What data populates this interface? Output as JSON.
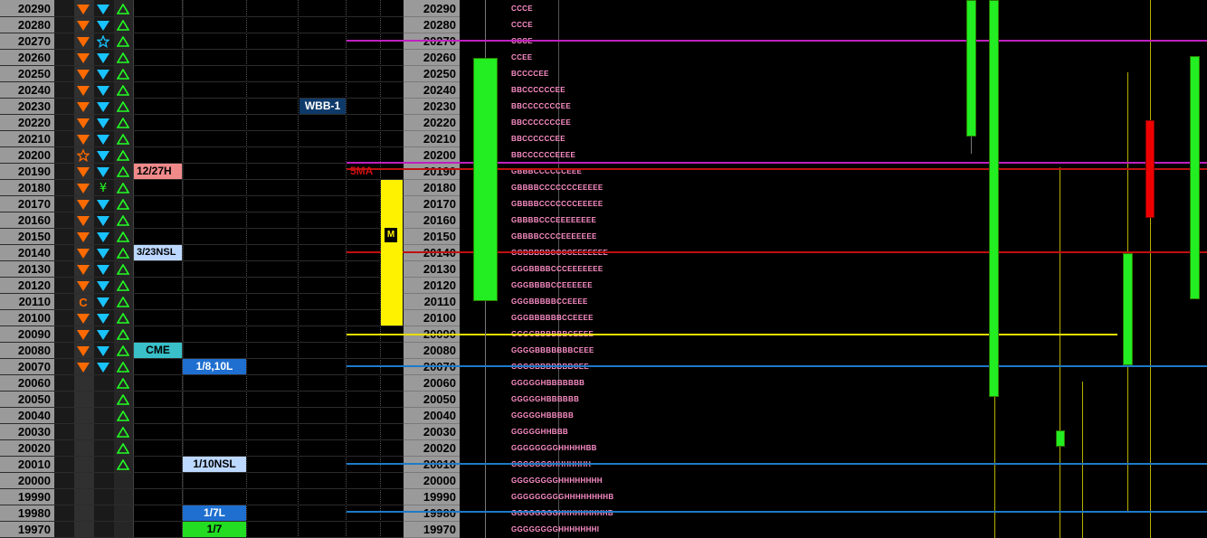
{
  "price_ladder": {
    "rows": [
      {
        "price": "20290",
        "marks": [
          "tri-down",
          "tri-down",
          "tri-up"
        ],
        "tpo": "CCCE"
      },
      {
        "price": "20280",
        "marks": [
          "tri-down",
          "tri-down",
          "tri-up"
        ],
        "tpo": "CCCE"
      },
      {
        "price": "20270",
        "marks": [
          "tri-down",
          "star",
          "tri-up"
        ],
        "tpo": "CCCE"
      },
      {
        "price": "20260",
        "marks": [
          "tri-down",
          "tri-down",
          "tri-up"
        ],
        "tpo": "CCEE"
      },
      {
        "price": "20250",
        "marks": [
          "tri-down",
          "tri-down",
          "tri-up"
        ],
        "tpo": "BCCCCEE"
      },
      {
        "price": "20240",
        "marks": [
          "tri-down",
          "tri-down",
          "tri-up"
        ],
        "tpo": "BBCCCCCCEE"
      },
      {
        "price": "20230",
        "marks": [
          "tri-down",
          "tri-down",
          "tri-up"
        ],
        "tpo": "BBCCCCCCCEE"
      },
      {
        "price": "20220",
        "marks": [
          "tri-down",
          "tri-down",
          "tri-up"
        ],
        "tpo": "BBCCCCCCCEE"
      },
      {
        "price": "20210",
        "marks": [
          "tri-down",
          "tri-down",
          "tri-up"
        ],
        "tpo": "BBCCCCCCEE"
      },
      {
        "price": "20200",
        "marks": [
          "star",
          "tri-down",
          "tri-up"
        ],
        "tpo": "BBCCCCCCEEEE"
      },
      {
        "price": "20190",
        "marks": [
          "tri-down",
          "tri-down",
          "tri-up"
        ],
        "tpo": "GBBBCCCCCCEEE"
      },
      {
        "price": "20180",
        "marks": [
          "tri-down",
          "yen",
          "tri-up"
        ],
        "tpo": "GBBBBCCCCCCCEEEEE"
      },
      {
        "price": "20170",
        "marks": [
          "tri-down",
          "tri-down",
          "tri-up"
        ],
        "tpo": "GBBBBCCCCCCCEEEEE"
      },
      {
        "price": "20160",
        "marks": [
          "tri-down",
          "tri-down",
          "tri-up"
        ],
        "tpo": "GBBBBCCCEEEEEEEE"
      },
      {
        "price": "20150",
        "marks": [
          "tri-down",
          "tri-down",
          "tri-up"
        ],
        "tpo": "GBBBBCCCCEEEEEEE"
      },
      {
        "price": "20140",
        "marks": [
          "tri-down",
          "tri-down",
          "tri-up"
        ],
        "tpo": "GGBBBBBCCCCEEEEEEE"
      },
      {
        "price": "20130",
        "marks": [
          "tri-down",
          "tri-down",
          "tri-up"
        ],
        "tpo": "GGGBBBBCCCEEEEEEE"
      },
      {
        "price": "20120",
        "marks": [
          "tri-down",
          "tri-down",
          "tri-up"
        ],
        "tpo": "GGGBBBBCCEEEEEE"
      },
      {
        "price": "20110",
        "marks": [
          "C",
          "tri-down",
          "tri-up"
        ],
        "tpo": "GGGBBBBBCCEEEE"
      },
      {
        "price": "20100",
        "marks": [
          "tri-down",
          "tri-down",
          "tri-up"
        ],
        "tpo": "GGGBBBBBBCCEEEE"
      },
      {
        "price": "20090",
        "marks": [
          "tri-down",
          "tri-down",
          "tri-up"
        ],
        "tpo": "GGGGBBBBBBCEEEE"
      },
      {
        "price": "20080",
        "marks": [
          "tri-down",
          "tri-down",
          "tri-up"
        ],
        "tpo": "GGGGBBBBBBBCEEE"
      },
      {
        "price": "20070",
        "marks": [
          "tri-down",
          "tri-down",
          "tri-up"
        ],
        "tpo": "GGGGBBBBBBBCEE"
      },
      {
        "price": "20060",
        "marks": [
          "",
          "",
          "tri-up"
        ],
        "tpo": "GGGGGHBBBBBBB"
      },
      {
        "price": "20050",
        "marks": [
          "",
          "",
          "tri-up"
        ],
        "tpo": "GGGGGHBBBBBB"
      },
      {
        "price": "20040",
        "marks": [
          "",
          "",
          "tri-up"
        ],
        "tpo": "GGGGGHBBBBB"
      },
      {
        "price": "20030",
        "marks": [
          "",
          "",
          "tri-up"
        ],
        "tpo": "GGGGGHHBBB"
      },
      {
        "price": "20020",
        "marks": [
          "",
          "",
          "tri-up"
        ],
        "tpo": "GGGGGGGGHHHHHBB"
      },
      {
        "price": "20010",
        "marks": [
          "",
          "",
          "tri-up"
        ],
        "tpo": "GGGGGGGHHHHHHH"
      },
      {
        "price": "20000",
        "marks": [
          "",
          "",
          ""
        ],
        "tpo": "GGGGGGGGHHHHHHHH"
      },
      {
        "price": "19990",
        "marks": [
          "",
          "",
          ""
        ],
        "tpo": "GGGGGGGGGHHHHHHHHB"
      },
      {
        "price": "19980",
        "marks": [
          "",
          "",
          ""
        ],
        "tpo": "GGGGGGGGHHHHHHHHHB"
      },
      {
        "price": "19970",
        "marks": [
          "",
          "",
          ""
        ],
        "tpo": "GGGGGGGGHHHHHHHI"
      }
    ]
  },
  "tags": {
    "h1227": "12/27H",
    "nsl323": "3/23NSL",
    "cme": "CME",
    "l18": "1/8,10L",
    "nsl110": "1/10NSL",
    "l17": "1/7L",
    "d17": "1/7",
    "wbb": "WBB-1",
    "sma": "5MA",
    "m": "M"
  },
  "colors": {
    "ladder_bg": "#9a9a9a",
    "tri_orange": "#ff6a00",
    "tri_cyan": "#19c3ff",
    "tri_green": "#22ff22",
    "candle_green": "#22ee22",
    "candle_red": "#ee0000",
    "line_purple": "#c020c0",
    "line_red": "#c01010",
    "line_yellow": "#e8e000",
    "line_blue": "#1e7ac8"
  }
}
